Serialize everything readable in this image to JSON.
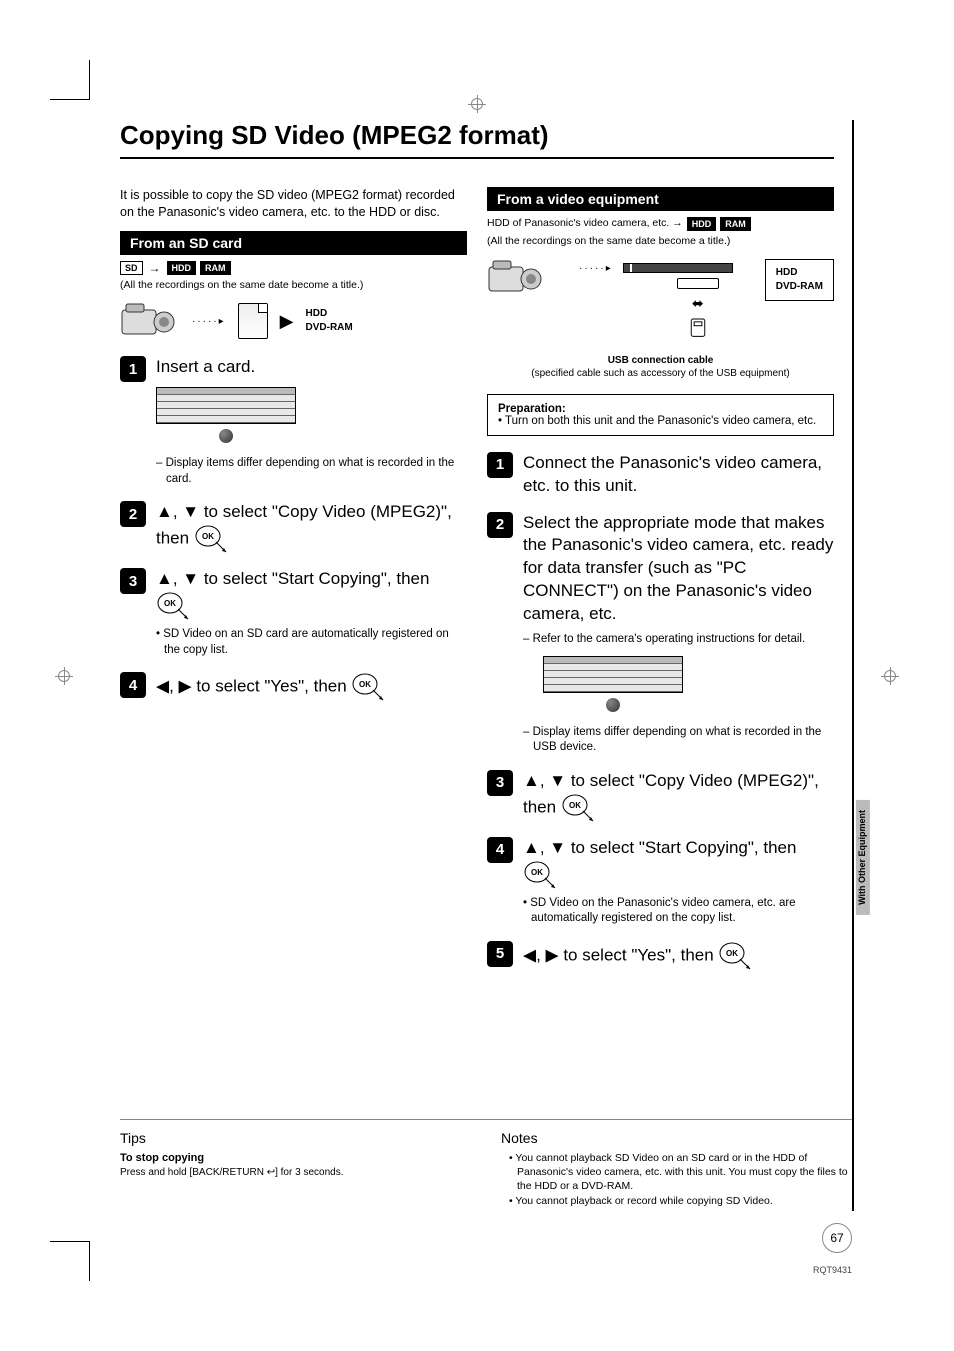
{
  "title": "Copying SD Video (MPEG2 format)",
  "leftCol": {
    "intro": "It is possible to copy the SD video (MPEG2 format) recorded on the Panasonic's video camera, etc. to the HDD or disc.",
    "sectionTitle": "From an SD card",
    "badges": {
      "src": "SD",
      "sep": "→",
      "dst1": "HDD",
      "dst2": "RAM"
    },
    "badgeNote": "(All the recordings on the same date become a title.)",
    "diagramLabels": {
      "hdd": "HDD",
      "ram": "DVD-RAM"
    },
    "steps": [
      {
        "num": "1",
        "text": "Insert a card.",
        "note": "– Display items differ depending on what is recorded in the card."
      },
      {
        "num": "2",
        "text_a": "▲, ▼ to select \"Copy Video (MPEG2)\", then "
      },
      {
        "num": "3",
        "text_a": "▲, ▼ to select \"Start Copying\", then ",
        "note": "• SD Video on an SD card are automatically registered on the copy list."
      },
      {
        "num": "4",
        "text_a": "◀, ▶ to select \"Yes\", then "
      }
    ]
  },
  "rightCol": {
    "sectionTitle": "From a video equipment",
    "badgeLine": "HDD of Panasonic's video camera, etc. →",
    "badges": {
      "dst1": "HDD",
      "dst2": "RAM"
    },
    "badgeNote": "(All the recordings on the same date become a title.)",
    "diagramLabels": {
      "hdd": "HDD",
      "ram": "DVD-RAM"
    },
    "usbTitle": "USB connection cable",
    "usbNote": "(specified cable such as accessory of the USB equipment)",
    "prepTitle": "Preparation:",
    "prepItem": "Turn on both this unit and the Panasonic's video camera, etc.",
    "steps": [
      {
        "num": "1",
        "text": "Connect the Panasonic's video camera, etc. to this unit."
      },
      {
        "num": "2",
        "text": "Select the appropriate mode that makes the Panasonic's video camera, etc. ready for data transfer (such as \"PC CONNECT\") on the Panasonic's video camera, etc.",
        "note1": "– Refer to the camera's operating instructions for detail.",
        "note2": "– Display items differ depending on what is recorded in the USB device."
      },
      {
        "num": "3",
        "text_a": "▲, ▼ to select \"Copy Video (MPEG2)\", then "
      },
      {
        "num": "4",
        "text_a": "▲, ▼ to select \"Start Copying\", then ",
        "note": "• SD Video on the Panasonic's video camera, etc. are automatically registered on the copy list."
      },
      {
        "num": "5",
        "text_a": "◀, ▶ to select \"Yes\", then "
      }
    ]
  },
  "sideTab": "With Other Equipment",
  "tips": {
    "heading": "Tips",
    "subheading": "To stop copying",
    "text": "Press and hold [BACK/RETURN ↩] for 3 seconds."
  },
  "notes": {
    "heading": "Notes",
    "items": [
      "You cannot playback SD Video on an SD card or in the HDD of Panasonic's video camera, etc. with this unit. You must copy the files to the HDD or a DVD-RAM.",
      "You cannot playback or record while copying SD Video."
    ]
  },
  "pageNum": "67",
  "docCode": "RQT9431"
}
